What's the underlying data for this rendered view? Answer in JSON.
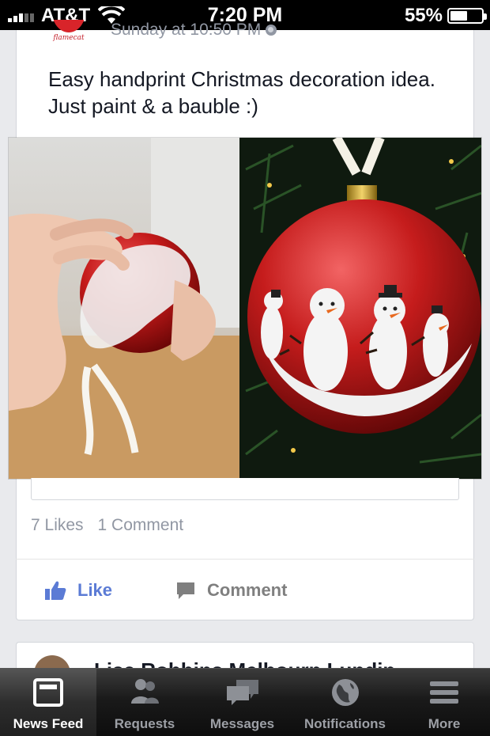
{
  "status_bar": {
    "carrier": "AT&T",
    "time": "7:20 PM",
    "battery_percent": "55%",
    "battery_level": 0.55,
    "signal_bars": 3
  },
  "post": {
    "page_logo_text": "flamecat",
    "timestamp": "Sunday at 10:50 PM",
    "text": "Easy handprint Christmas decoration idea. Just paint & a bauble :)",
    "likes": "7 Likes",
    "comments": "1 Comment",
    "like_label": "Like",
    "comment_label": "Comment",
    "like_color": "#5b7bd5",
    "comment_color": "#7f7f7f"
  },
  "next_post": {
    "author": "Lisa Robbins Melbourn Lundin"
  },
  "tab_bar": {
    "tabs": [
      {
        "label": "News Feed",
        "icon": "news-feed-icon",
        "active": true
      },
      {
        "label": "Requests",
        "icon": "friend-requests-icon",
        "active": false
      },
      {
        "label": "Messages",
        "icon": "messages-icon",
        "active": false
      },
      {
        "label": "Notifications",
        "icon": "globe-icon",
        "active": false
      },
      {
        "label": "More",
        "icon": "menu-icon",
        "active": false
      }
    ]
  }
}
